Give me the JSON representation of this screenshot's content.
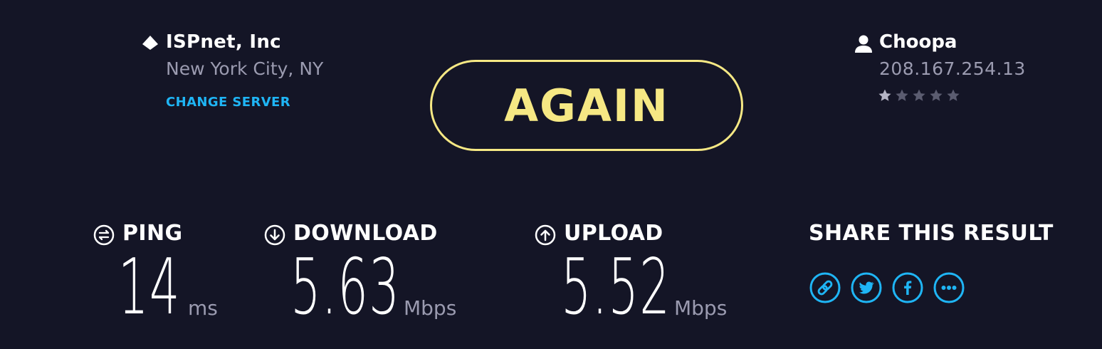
{
  "isp": {
    "name": "ISPnet, Inc",
    "location": "New York City, NY",
    "change_server_label": "CHANGE SERVER"
  },
  "again_button": {
    "label": "AGAIN"
  },
  "host": {
    "name": "Choopa",
    "ip": "208.167.254.13",
    "rating": 1,
    "rating_max": 5
  },
  "metrics": {
    "ping": {
      "label": "PING",
      "value": "14",
      "unit": "ms",
      "icon": "ping-icon"
    },
    "download": {
      "label": "DOWNLOAD",
      "value": "5.63",
      "unit": "Mbps",
      "icon": "download-arrow-icon"
    },
    "upload": {
      "label": "UPLOAD",
      "value": "5.52",
      "unit": "Mbps",
      "icon": "upload-arrow-icon"
    }
  },
  "share": {
    "label": "SHARE THIS RESULT",
    "icons": [
      "link-icon",
      "twitter-icon",
      "facebook-icon",
      "more-icon"
    ]
  },
  "colors": {
    "background": "#141526",
    "accent_yellow": "#f6e884",
    "accent_blue": "#1fb5f5",
    "muted_text": "#9b9bb0",
    "text": "#ffffff"
  }
}
